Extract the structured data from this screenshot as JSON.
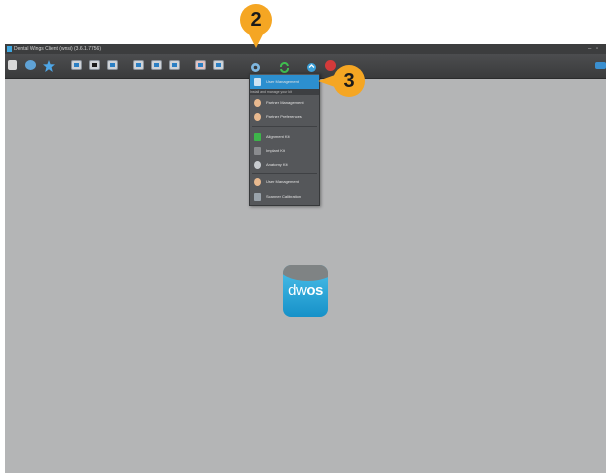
{
  "window": {
    "title": "Dental Wings Client (wnsi)  (3.6.1.7756)"
  },
  "toolbar": {
    "icons": [
      "edit-icon",
      "tools-icon",
      "star-icon",
      "monitor-icon",
      "monitor-dark-icon",
      "monitor-icon",
      "monitor-icon",
      "monitor-icon",
      "monitor-icon",
      "monitor-red-icon",
      "monitor-icon",
      "settings-icon",
      "sync-icon",
      "update-icon",
      "shutdown-icon",
      "expand-icon"
    ]
  },
  "callouts": {
    "step2": "2",
    "step3": "3"
  },
  "menu": {
    "items": [
      {
        "label": "User Management",
        "icon": "user-management-icon",
        "selected": true
      },
      {
        "label": "Partner Management",
        "icon": "partner-icon"
      },
      {
        "label": "Partner Preferences",
        "icon": "partner-preferences-icon"
      },
      {
        "label": "Alignment Kit",
        "icon": "alignment-kit-icon"
      },
      {
        "label": "Implant Kit",
        "icon": "implant-kit-icon"
      },
      {
        "label": "Anatomy Kit",
        "icon": "anatomy-kit-icon"
      },
      {
        "label": "User Management",
        "icon": "user-icon"
      },
      {
        "label": "Scanner Calibration",
        "icon": "scanner-calibration-icon"
      }
    ],
    "subtext": "Install and manage your kit"
  },
  "logo": {
    "text_light": "dw",
    "text_bold": "os"
  },
  "colors": {
    "accent": "#2c8fcf",
    "callout": "#f5a623",
    "workspace": "#b4b5b6",
    "toolbar": "#414244"
  }
}
